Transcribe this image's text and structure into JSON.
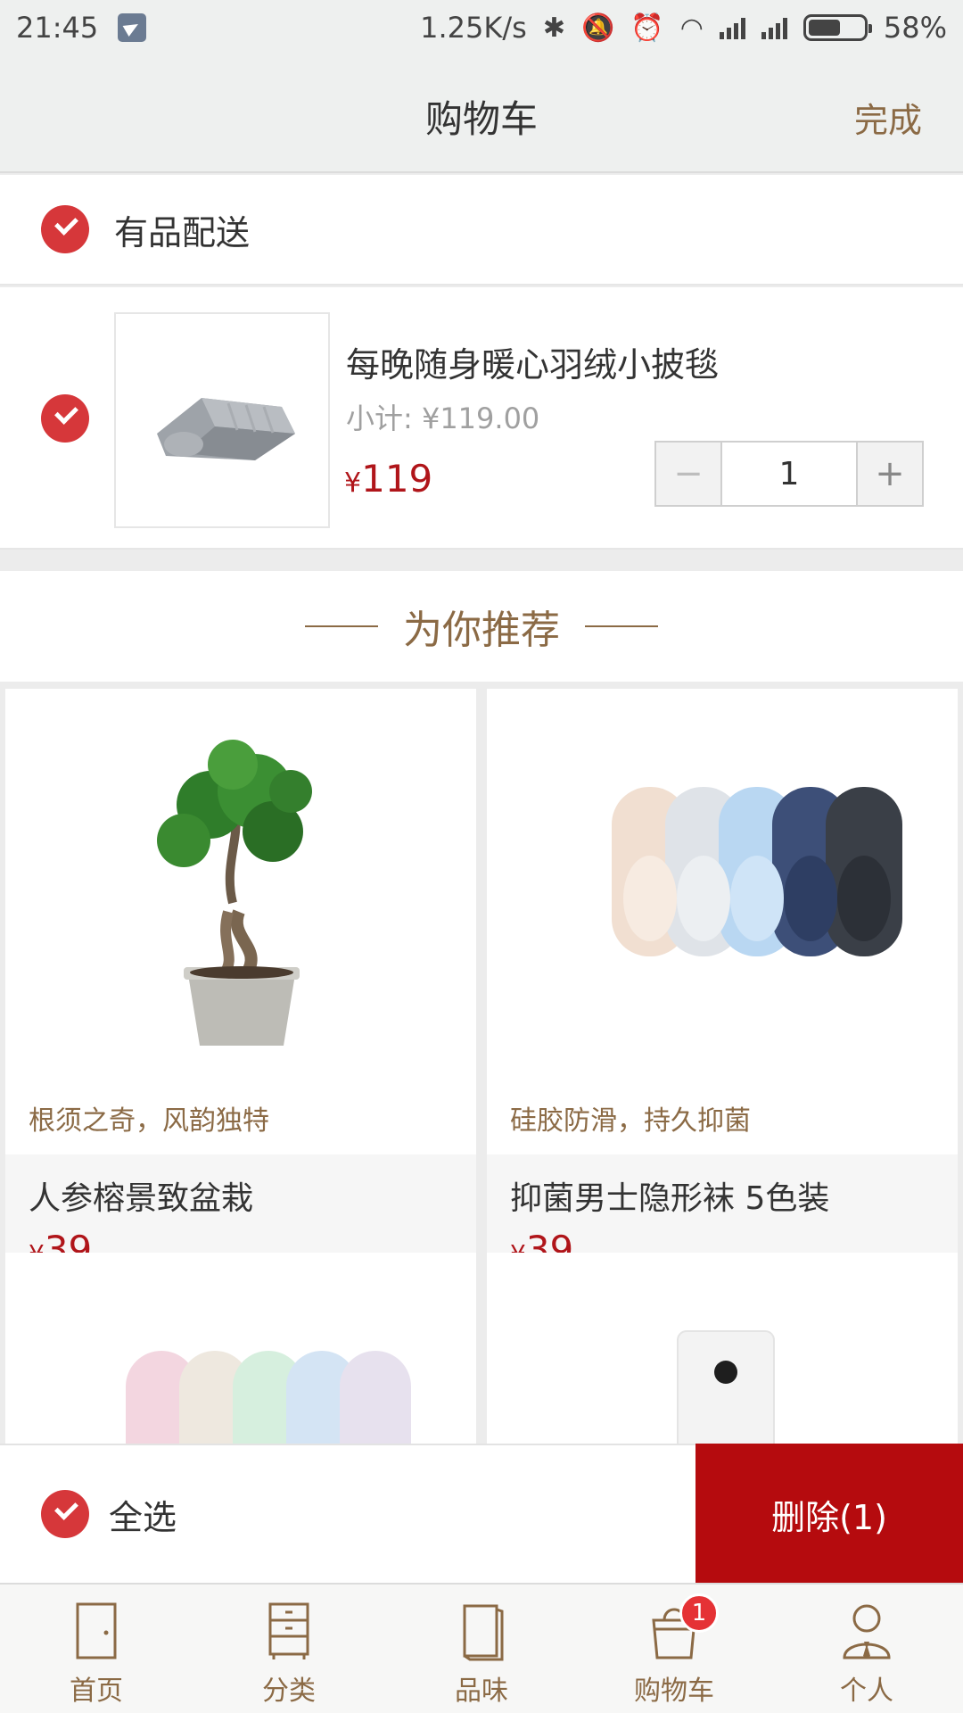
{
  "status_bar": {
    "time": "21:45",
    "net_speed": "1.25K/s",
    "battery": "58%",
    "battery_level": 0.58
  },
  "header": {
    "title": "购物车",
    "done_label": "完成"
  },
  "cart": {
    "section_label": "有品配送",
    "item": {
      "name": "每晚随身暖心羽绒小披毯",
      "subtotal": "小计: ¥119.00",
      "price_symbol": "¥",
      "price": "119",
      "quantity": "1"
    }
  },
  "recommend": {
    "title": "为你推荐",
    "products": [
      {
        "tagline": "根须之奇，风韵独特",
        "name": "人参榕景致盆栽",
        "price_symbol": "¥",
        "price": "39"
      },
      {
        "tagline": "硅胶防滑，持久抑菌",
        "name": "抑菌男士隐形袜 5色装",
        "price_symbol": "¥",
        "price": "39"
      }
    ]
  },
  "action_bar": {
    "select_all": "全选",
    "delete": "删除(1)"
  },
  "tabs": [
    {
      "label": "首页",
      "icon": "door-icon"
    },
    {
      "label": "分类",
      "icon": "cabinet-icon"
    },
    {
      "label": "品味",
      "icon": "book-icon"
    },
    {
      "label": "购物车",
      "icon": "bag-icon",
      "badge": "1"
    },
    {
      "label": "个人",
      "icon": "person-icon"
    }
  ],
  "colors": {
    "accent_brown": "#8b6a45",
    "price_red": "#b0151a",
    "check_red": "#d6373a",
    "delete_red": "#b50b0e"
  }
}
